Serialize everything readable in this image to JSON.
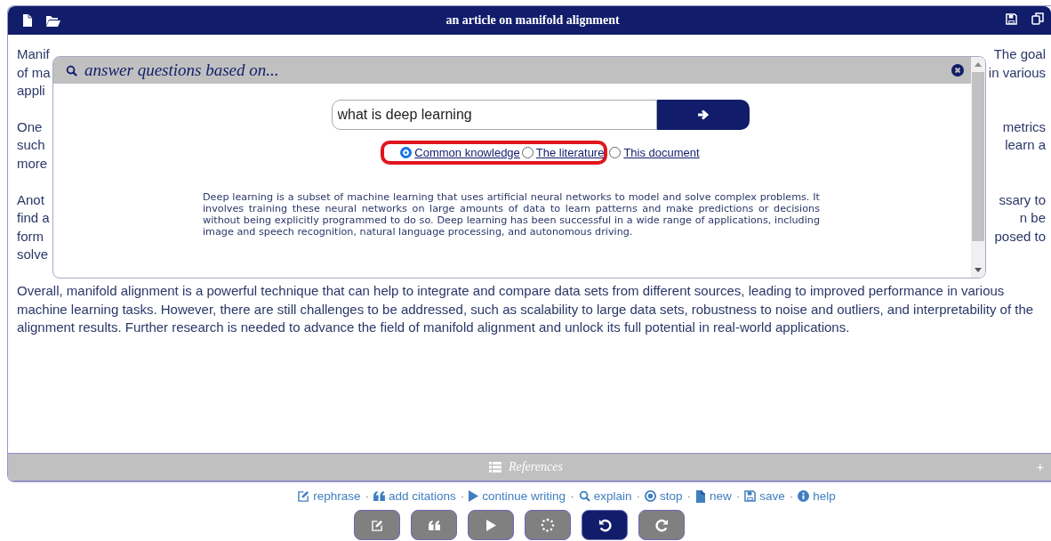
{
  "window": {
    "title": "an article on manifold alignment"
  },
  "article": {
    "paragraphs": [
      [
        {
          "left": "Manif",
          "right": "The goal"
        },
        {
          "left": "of ma",
          "right": "in various"
        },
        {
          "left": "appli"
        }
      ],
      [
        {
          "left": "One",
          "right": "metrics"
        },
        {
          "left": "such",
          "right": "learn a"
        },
        {
          "left": "more"
        }
      ],
      [
        {
          "left": "Anot",
          "right": "ssary to"
        },
        {
          "left": "find a",
          "right": "n be"
        },
        {
          "left": "form",
          "right": "posed to"
        },
        {
          "left": "solve"
        }
      ],
      [
        {
          "text": "Overall, manifold alignment is a powerful technique that can help to integrate and compare data sets from different sources, leading to improved performance in various machine learning tasks. However, there are still challenges to be addressed, such as scalability to large data sets, robustness to noise and outliers, and interpretability of the alignment results. Further research is needed to advance the field of manifold alignment and unlock its full potential in real-world applications."
        }
      ]
    ]
  },
  "dialog": {
    "title": "answer questions based on...",
    "query": "what is deep learning",
    "sources": [
      {
        "label": "Common knowledge",
        "selected": true,
        "outlined": true
      },
      {
        "label": "The literature",
        "selected": false,
        "outlined": true
      },
      {
        "label": "This document",
        "selected": false,
        "outlined": false
      }
    ],
    "answer": "Deep learning is a subset of machine learning that uses artificial neural networks to model and solve complex problems. It involves training these neural networks on large amounts of data to learn patterns and make predictions or decisions without being explicitly programmed to do so. Deep learning has been successful in a wide range of applications, including image and speech recognition, natural language processing, and autonomous driving."
  },
  "references": {
    "title": "References",
    "expand": "+"
  },
  "actions": {
    "separator": "·",
    "links": [
      {
        "label": "rephrase"
      },
      {
        "label": "add citations"
      },
      {
        "label": "continue writing"
      },
      {
        "label": "explain"
      },
      {
        "label": "stop"
      },
      {
        "label": "new"
      },
      {
        "label": "save"
      },
      {
        "label": "help"
      }
    ]
  },
  "toolbar": [
    {
      "active": false
    },
    {
      "active": false
    },
    {
      "active": false
    },
    {
      "active": false
    },
    {
      "active": true
    },
    {
      "active": false
    }
  ]
}
